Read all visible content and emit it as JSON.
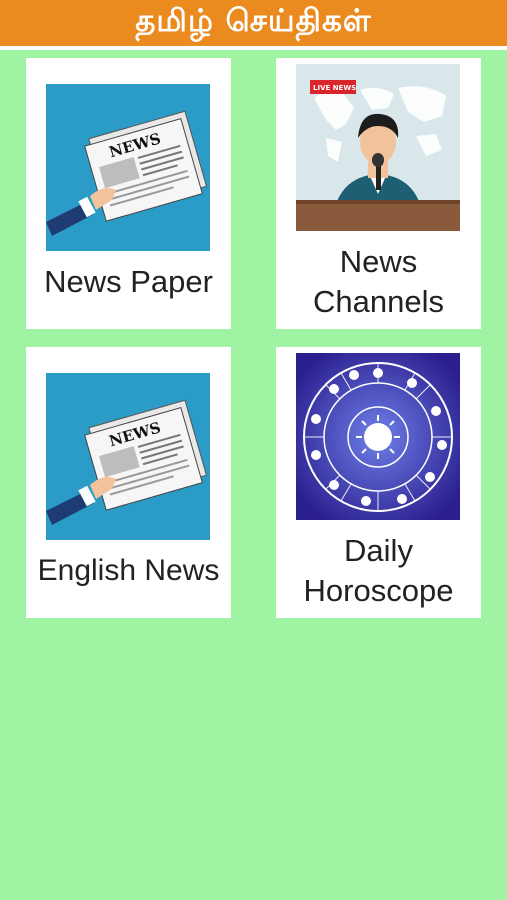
{
  "appbar": {
    "title": "தமிழ் செய்திகள்"
  },
  "cards": [
    {
      "label": "News Paper"
    },
    {
      "label_line1": "News",
      "label_line2": "Channels"
    },
    {
      "label": "English News"
    },
    {
      "label_line1": "Daily",
      "label_line2": "Horoscope"
    }
  ],
  "images": {
    "newspaper_text": "NEWS",
    "live_badge": "LIVE NEWS"
  },
  "colors": {
    "appbar": "#ea8a1f",
    "background": "#a0f3a3",
    "newspaper_bg": "#2a9cc7"
  }
}
